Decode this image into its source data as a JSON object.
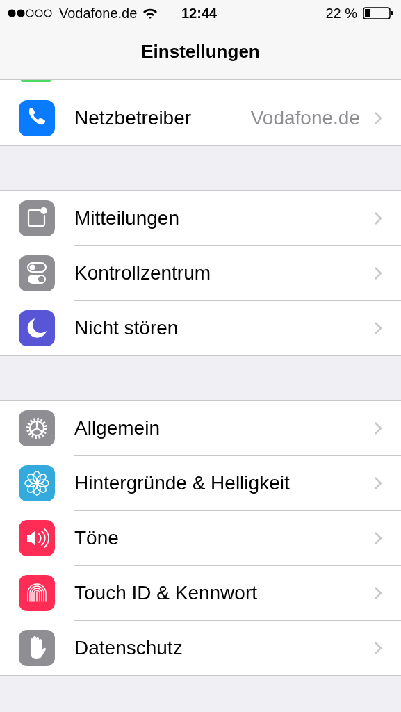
{
  "status_bar": {
    "carrier": "Vodafone.de",
    "time": "12:44",
    "battery": "22 %"
  },
  "nav": {
    "title": "Einstellungen"
  },
  "groups": [
    {
      "rows": [
        {
          "kind": "phone",
          "color": "#0a7aff",
          "label": "Netzbetreiber",
          "value": "Vodafone.de"
        }
      ]
    },
    {
      "rows": [
        {
          "kind": "notifications",
          "color": "#8e8e93",
          "label": "Mitteilungen"
        },
        {
          "kind": "control",
          "color": "#8e8e93",
          "label": "Kontrollzentrum"
        },
        {
          "kind": "moon",
          "color": "#5856d6",
          "label": "Nicht stören"
        }
      ]
    },
    {
      "rows": [
        {
          "kind": "gear",
          "color": "#8e8e93",
          "label": "Allgemein"
        },
        {
          "kind": "flower",
          "color": "#34aadc",
          "label": "Hintergründe & Helligkeit"
        },
        {
          "kind": "speaker",
          "color": "#ff2d55",
          "label": "Töne"
        },
        {
          "kind": "fingerprint",
          "color": "#ff2d55",
          "label": "Touch ID & Kennwort"
        },
        {
          "kind": "hand",
          "color": "#8e8e93",
          "label": "Datenschutz"
        }
      ]
    }
  ]
}
